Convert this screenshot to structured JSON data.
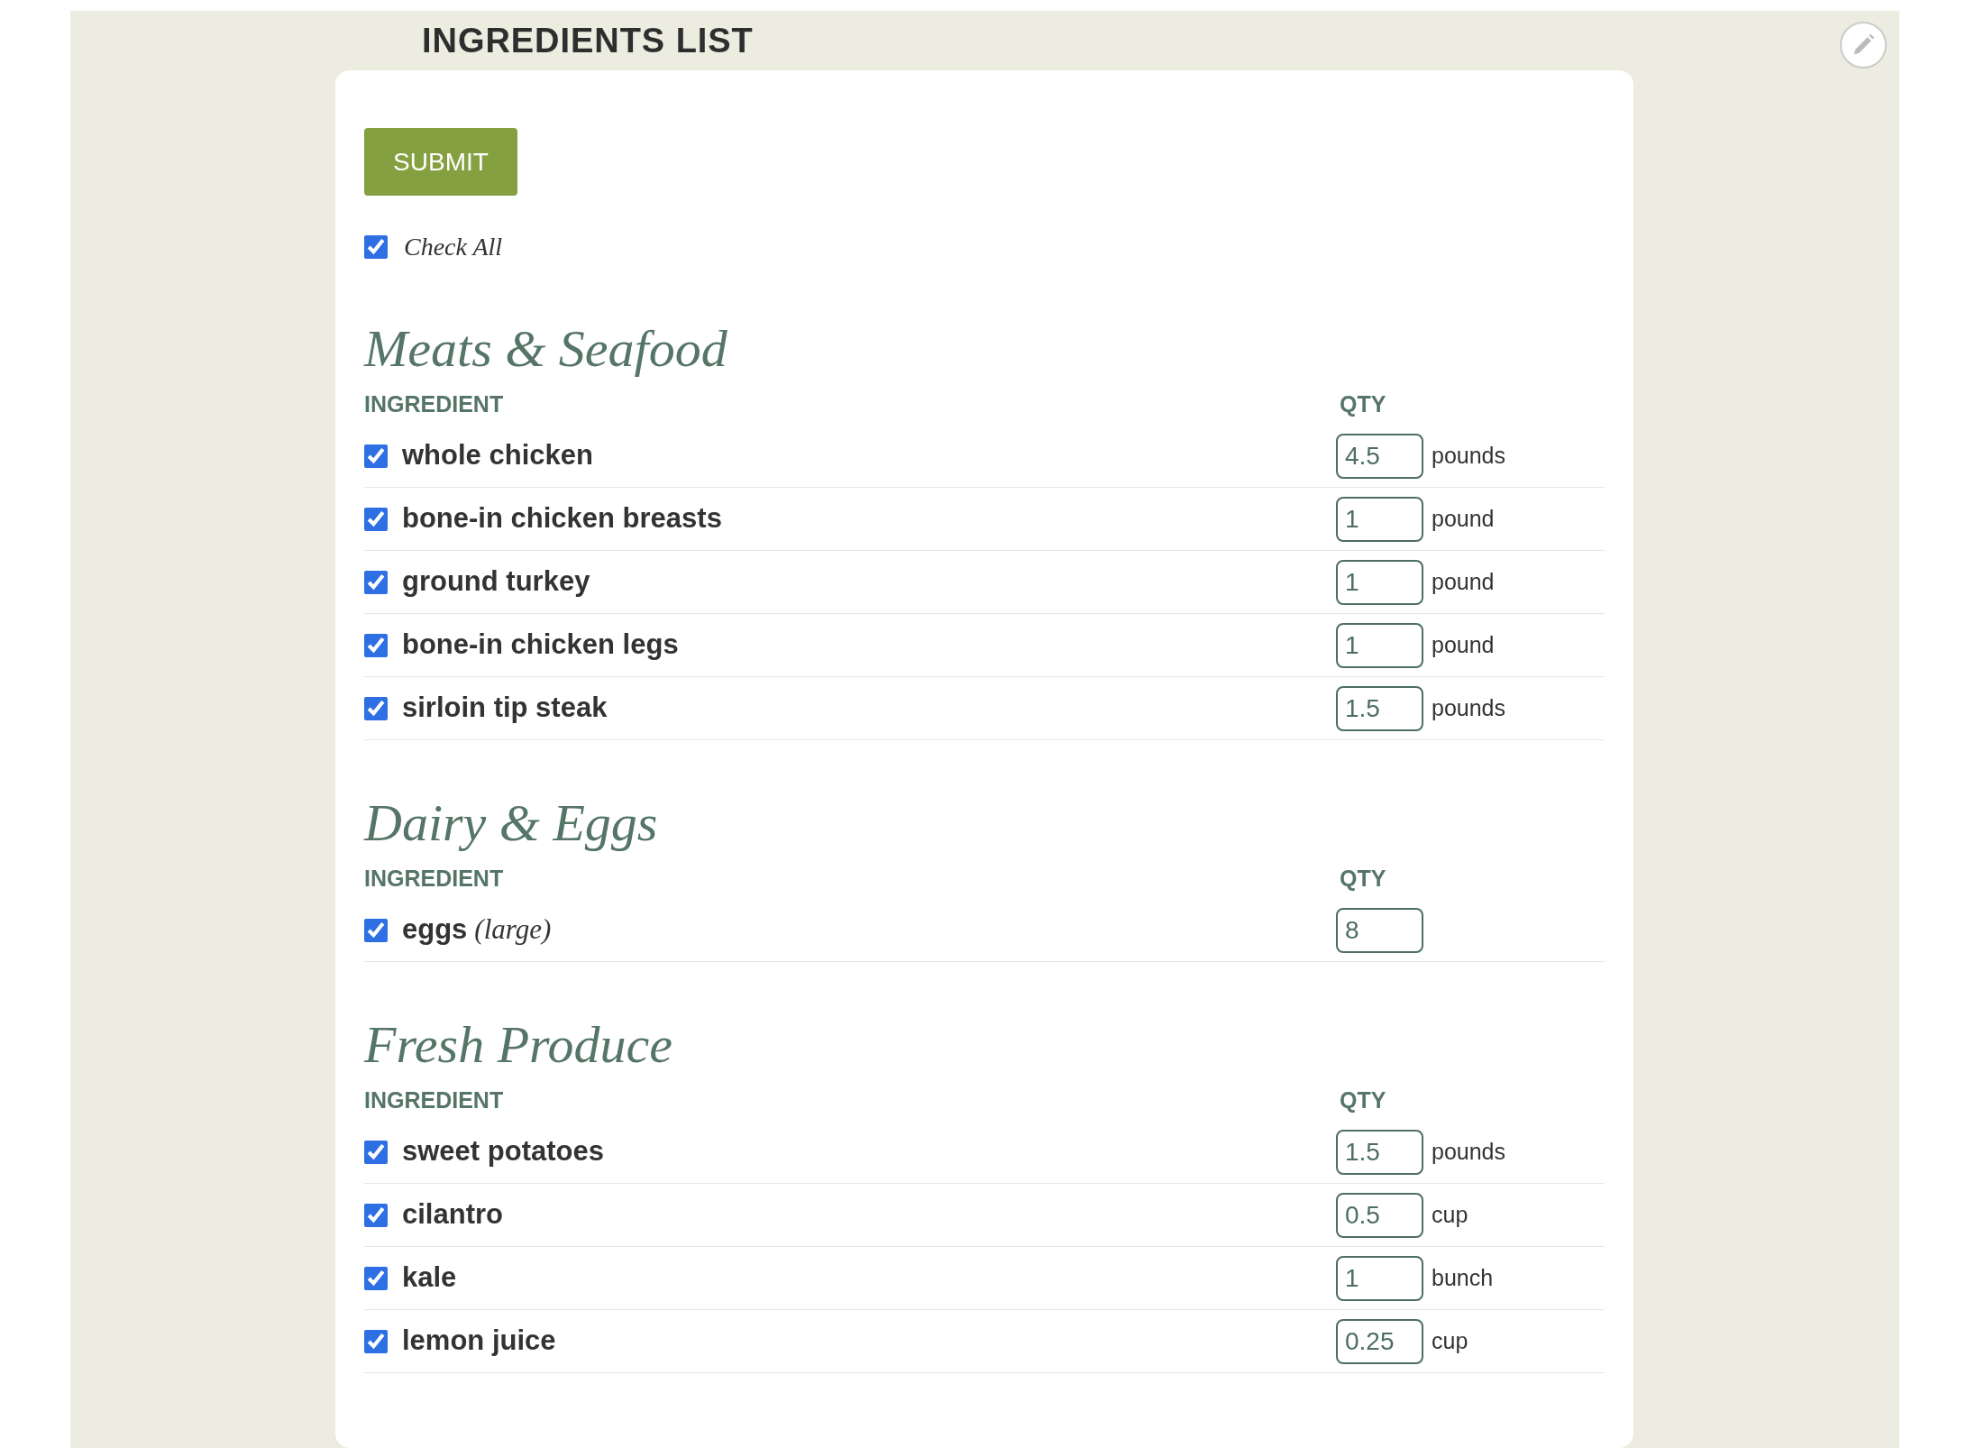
{
  "title": "INGREDIENTS LIST",
  "submit": "SUBMIT",
  "check_all": {
    "label": "Check All",
    "checked": true
  },
  "sections": [
    {
      "title": "Meats & Seafood",
      "columns": [
        "INGREDIENT",
        "QTY"
      ],
      "items": [
        {
          "name": "whole chicken",
          "qty": "4.5",
          "unit": "pounds",
          "checked": true
        },
        {
          "name": "bone-in chicken breasts",
          "qty": "1",
          "unit": "pound",
          "checked": true
        },
        {
          "name": "ground turkey",
          "qty": "1",
          "unit": "pound",
          "checked": true
        },
        {
          "name": "bone-in chicken legs",
          "qty": "1",
          "unit": "pound",
          "checked": true
        },
        {
          "name": "sirloin tip steak",
          "qty": "1.5",
          "unit": "pounds",
          "checked": true
        }
      ]
    },
    {
      "title": "Dairy & Eggs",
      "columns": [
        "INGREDIENT",
        "QTY"
      ],
      "items": [
        {
          "name": "eggs",
          "note": "(large)",
          "qty": "8",
          "checked": true
        }
      ]
    },
    {
      "title": "Fresh Produce",
      "columns": [
        "INGREDIENT",
        "QTY"
      ],
      "items": [
        {
          "name": "sweet potatoes",
          "qty": "1.5",
          "unit": "pounds",
          "checked": true
        },
        {
          "name": "cilantro",
          "qty": "0.5",
          "unit": "cup",
          "checked": true
        },
        {
          "name": "kale",
          "qty": "1",
          "unit": "bunch",
          "checked": true
        },
        {
          "name": "lemon juice",
          "qty": "0.25",
          "unit": "cup",
          "checked": true
        }
      ]
    }
  ]
}
